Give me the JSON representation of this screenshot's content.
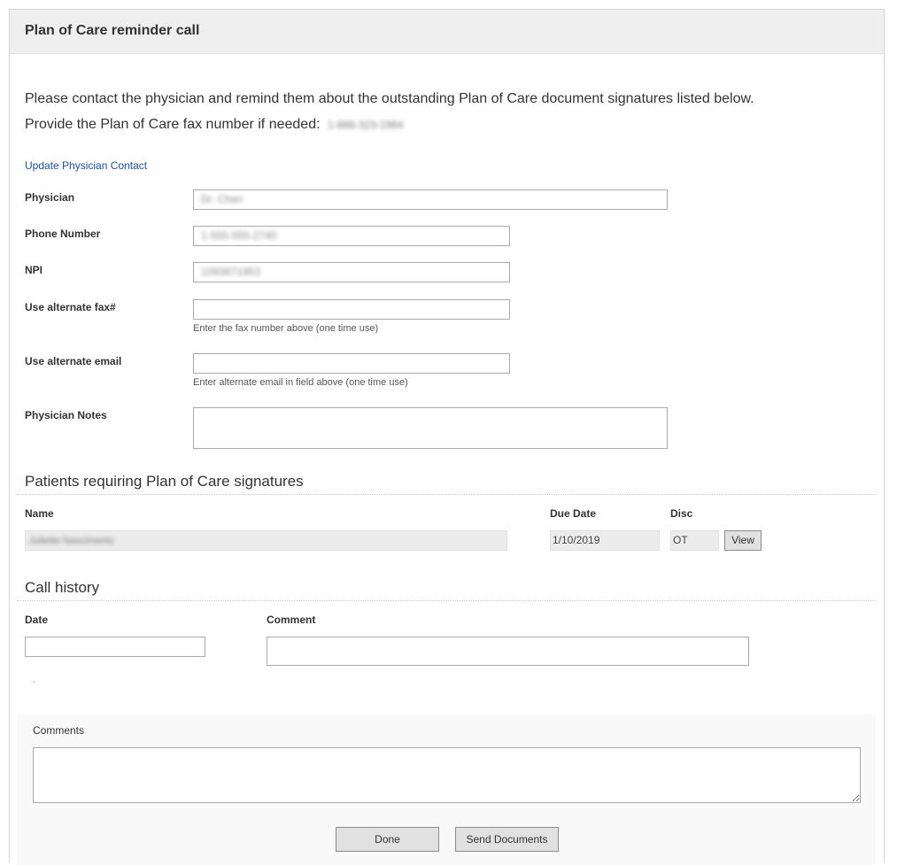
{
  "header": {
    "title": "Plan of Care reminder call"
  },
  "intro": {
    "line1": "Please contact the physician and remind them about the outstanding Plan of Care document signatures listed below.",
    "line2": "Provide the Plan of Care fax number if needed:",
    "fax_number": "1-888-323-1964"
  },
  "physician_form": {
    "update_link": "Update Physician Contact",
    "physician_label": "Physician",
    "physician_value": "Dr. Chen",
    "phone_label": "Phone Number",
    "phone_value": "1-555-555-2740",
    "npi_label": "NPI",
    "npi_value": "1093671953",
    "alt_fax_label": "Use alternate fax#",
    "alt_fax_hint": "Enter the fax number above (one time use)",
    "alt_email_label": "Use alternate email",
    "alt_email_hint": "Enter alternate email in field above (one time use)",
    "notes_label": "Physician Notes"
  },
  "patients": {
    "title": "Patients requiring Plan of Care signatures",
    "columns": {
      "name": "Name",
      "due_date": "Due Date",
      "disc": "Disc"
    },
    "rows": [
      {
        "name": "Juliette Nascimento",
        "due_date": "1/10/2019",
        "disc": "OT",
        "view_label": "View"
      }
    ]
  },
  "call_history": {
    "title": "Call history",
    "date_label": "Date",
    "comment_label": "Comment",
    "dot": "."
  },
  "comments": {
    "label": "Comments"
  },
  "actions": {
    "done_label": "Done",
    "send_label": "Send Documents"
  }
}
